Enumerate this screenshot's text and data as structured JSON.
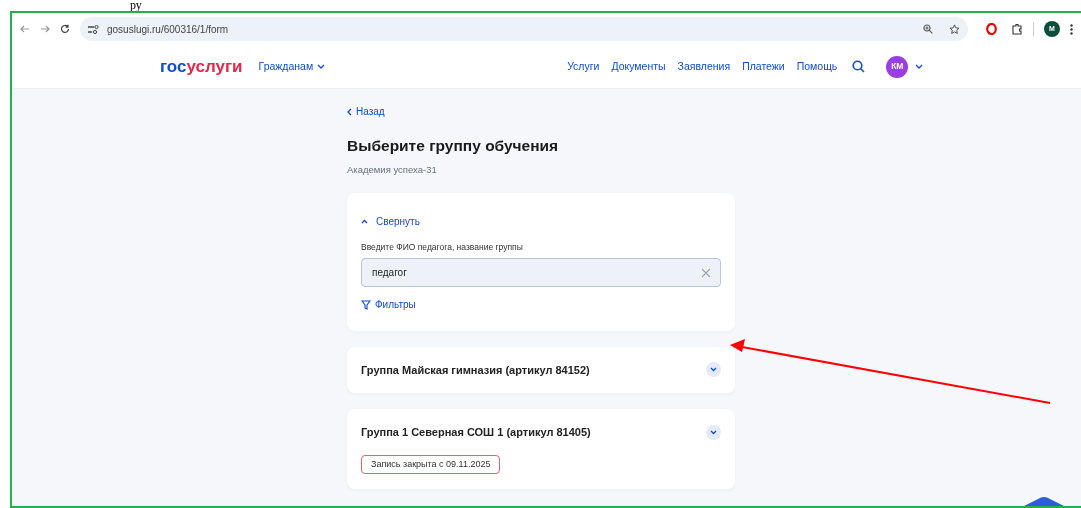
{
  "document_fragment": "ру",
  "browser": {
    "url": "gosuslugi.ru/600316/1/form",
    "profile_initial": "M"
  },
  "header": {
    "logo_parts": [
      "гос",
      "услуги"
    ],
    "audience_menu": "Гражданам",
    "nav": [
      "Услуги",
      "Документы",
      "Заявления",
      "Платежи",
      "Помощь"
    ],
    "avatar_initials": "КМ"
  },
  "page": {
    "back": "Назад",
    "title": "Выберите группу обучения",
    "subtitle": "Академия успеха-31"
  },
  "search_panel": {
    "collapse": "Свернуть",
    "expanded": true,
    "label": "Введите ФИО педагога, название группы",
    "value": "педагог",
    "filters": "Фильтры"
  },
  "groups": [
    {
      "title": "Группа Майская гимназия (артикул 84152)"
    },
    {
      "title": "Группа 1 Северная СОШ 1 (артикул 81405)",
      "status": "Запись закрыта с 09.11.2025"
    }
  ]
}
